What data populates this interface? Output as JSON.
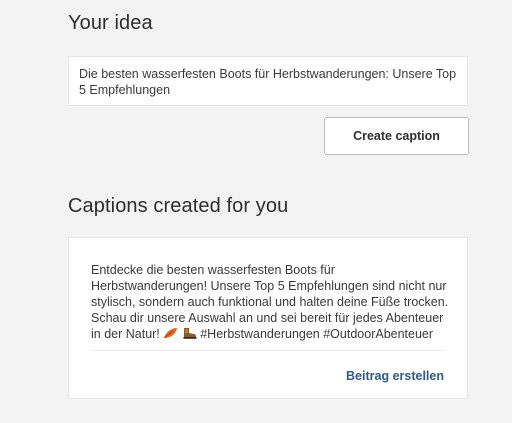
{
  "idea": {
    "heading": "Your idea",
    "text": "Die besten wasserfesten Boots für Herbstwanderungen: Unsere Top 5 Empfehlungen"
  },
  "actions": {
    "create_caption_label": "Create caption"
  },
  "captions": {
    "heading": "Captions created for you",
    "items": [
      {
        "text": "Entdecke die besten wasserfesten Boots für Herbstwanderungen! Unsere Top 5 Empfehlungen sind nicht nur stylisch, sondern auch funktional und halten deine Füße trocken. Schau dir unsere Auswahl an und sei bereit für jedes Abenteuer in der Natur!",
        "emojis": [
          "fallen-leaf-icon",
          "hiking-boot-icon"
        ],
        "hashtags": "#Herbstwanderungen #OutdoorAbenteuer",
        "post_label": "Beitrag erstellen"
      }
    ]
  },
  "colors": {
    "background": "#f3f3f3",
    "card": "#ffffff",
    "link": "#2e5c8a",
    "text": "#2f2f2f"
  }
}
